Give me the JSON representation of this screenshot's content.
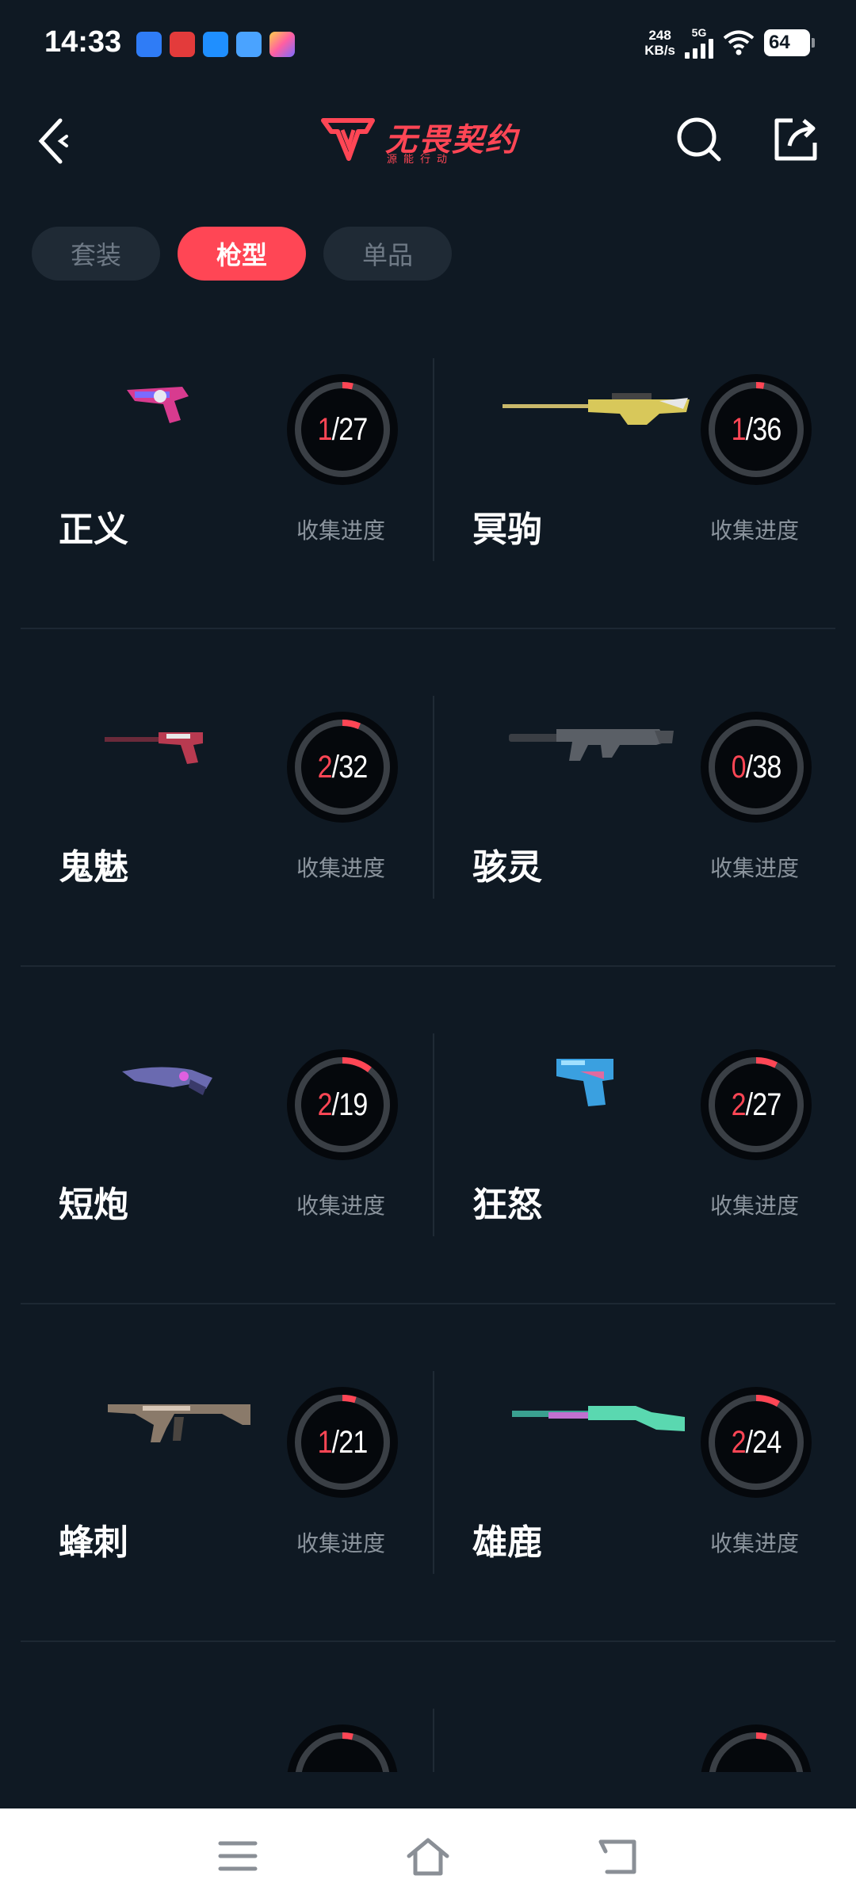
{
  "status_bar": {
    "time": "14:33",
    "speed_value": "248",
    "speed_unit": "KB/s",
    "network": "5G",
    "battery": "64",
    "app_icons": [
      {
        "name": "du-icon",
        "color": "#2f7cf6",
        "label": "du"
      },
      {
        "name": "red-app-icon",
        "color": "#e33b3b",
        "label": ""
      },
      {
        "name": "blue-app-icon",
        "color": "#1f8fff",
        "label": ""
      },
      {
        "name": "cyan-app-icon",
        "color": "#4aa3ff",
        "label": ""
      },
      {
        "name": "star-app-icon",
        "color": "#ff7eb6",
        "label": ""
      }
    ]
  },
  "header": {
    "logo_title": "无畏契约",
    "logo_subtitle": "源能行动",
    "back_icon": "chevron-left-icon",
    "search_icon": "search-icon",
    "share_icon": "share-icon"
  },
  "tabs": [
    {
      "label": "套装",
      "active": false
    },
    {
      "label": "枪型",
      "active": true
    },
    {
      "label": "单品",
      "active": false
    }
  ],
  "progress_label": "收集进度",
  "weapons": [
    {
      "name": "正义",
      "collected": 1,
      "total": 27
    },
    {
      "name": "冥驹",
      "collected": 1,
      "total": 36
    },
    {
      "name": "鬼魅",
      "collected": 2,
      "total": 32
    },
    {
      "name": "骇灵",
      "collected": 0,
      "total": 38
    },
    {
      "name": "短炮",
      "collected": 2,
      "total": 19
    },
    {
      "name": "狂怒",
      "collected": 2,
      "total": 27
    },
    {
      "name": "蜂刺",
      "collected": 1,
      "total": 21
    },
    {
      "name": "雄鹿",
      "collected": 2,
      "total": 24
    }
  ],
  "colors": {
    "background": "#0f1923",
    "accent": "#ff4655",
    "tab_inactive": "#1f2a35",
    "ring_track": "#3a3f45",
    "muted_text": "#8a939c"
  },
  "bottom_nav": {
    "menu_icon": "menu-icon",
    "home_icon": "home-icon",
    "back_icon": "back-icon"
  }
}
